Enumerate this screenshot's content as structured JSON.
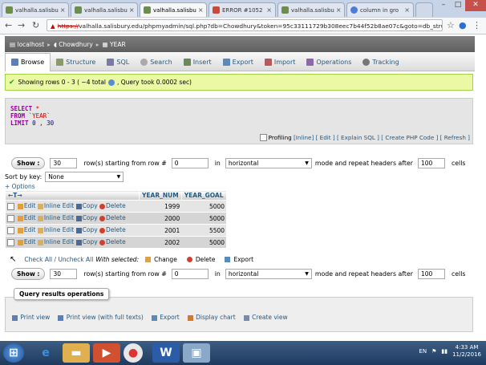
{
  "browser": {
    "tabs": [
      {
        "label": "valhalla.salisbu",
        "icon": "pma-icon",
        "active": false
      },
      {
        "label": "valhalla.salisbu",
        "icon": "pma-icon",
        "active": false
      },
      {
        "label": "valhalla.salisbu",
        "icon": "pma-icon",
        "active": true
      },
      {
        "label": "ERROR #1052",
        "icon": "error-icon",
        "active": false
      },
      {
        "label": "valhalla.salisbu",
        "icon": "pma-icon",
        "active": false
      },
      {
        "label": "column in gro",
        "icon": "google-icon",
        "active": false
      }
    ],
    "url_scheme": "https://",
    "url_rest": "valhalla.salisbury.edu/phpmyadmin/sql.php?db=Chowdhury&token=95c33111729b308eec7b44f52b8ae07c&goto=db_stru"
  },
  "breadcrumb": {
    "server": "localhost",
    "database": "Chowdhury",
    "table": "YEAR"
  },
  "menu": [
    "Browse",
    "Structure",
    "SQL",
    "Search",
    "Insert",
    "Export",
    "Import",
    "Operations",
    "Tracking"
  ],
  "success": {
    "text": "Showing rows 0 - 3 ( ~4 total",
    "text2": ", Query took 0.0002 sec)"
  },
  "sql": {
    "select": "SELECT",
    "star": " *",
    "from": "FROM",
    "table": " `YEAR`",
    "limit": "LIMIT",
    "limit_vals": " 0 , 30"
  },
  "sql_links": {
    "profiling": "Profiling",
    "inline": "[Inline]",
    "edit": "[ Edit ]",
    "explain": "[ Explain SQL ]",
    "create_php": "[ Create PHP Code ]",
    "refresh": "[ Refresh ]"
  },
  "nav": {
    "show_label": "Show :",
    "count": "30",
    "rows_from": "row(s) starting from row #",
    "start_row": "0",
    "in": "in",
    "mode": "horizontal",
    "mode_after": "mode and repeat headers after",
    "headers_after": "100",
    "cells": "cells"
  },
  "sort": {
    "label": "Sort by key:",
    "value": "None"
  },
  "options_label": "+ Options",
  "table": {
    "columns": [
      "YEAR_NUM",
      "YEAR_GOAL"
    ],
    "actions": {
      "edit": "Edit",
      "inline": "Inline Edit",
      "copy": "Copy",
      "delete": "Delete"
    },
    "rows": [
      {
        "year_num": "1999",
        "year_goal": "5000"
      },
      {
        "year_num": "2000",
        "year_goal": "5000"
      },
      {
        "year_num": "2001",
        "year_goal": "5500"
      },
      {
        "year_num": "2002",
        "year_goal": "5000"
      }
    ]
  },
  "bulk": {
    "check_all": "Check All / Uncheck All",
    "with_selected": "With selected:",
    "change": "Change",
    "delete": "Delete",
    "export": "Export"
  },
  "qro": {
    "title": "Query results operations",
    "print": "Print view",
    "print_full": "Print view (with full texts)",
    "export": "Export",
    "chart": "Display chart",
    "create_view": "Create view"
  },
  "taskbar": {
    "lang": "EN",
    "time": "4:33 AM",
    "date": "11/2/2016"
  }
}
